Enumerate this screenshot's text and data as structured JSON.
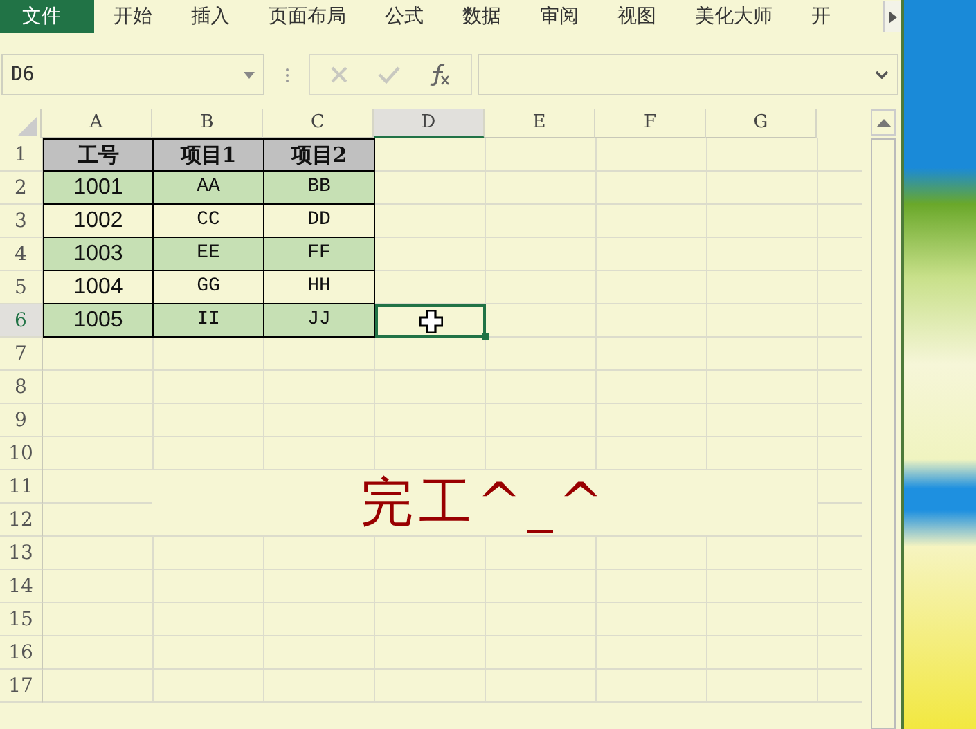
{
  "ribbon_tabs": [
    {
      "label": "文件",
      "selected": true
    },
    {
      "label": "开始",
      "selected": false
    },
    {
      "label": "插入",
      "selected": false
    },
    {
      "label": "页面布局",
      "selected": false
    },
    {
      "label": "公式",
      "selected": false
    },
    {
      "label": "数据",
      "selected": false
    },
    {
      "label": "审阅",
      "selected": false
    },
    {
      "label": "视图",
      "selected": false
    },
    {
      "label": "美化大师",
      "selected": false
    },
    {
      "label": "开",
      "selected": false
    }
  ],
  "name_box": {
    "value": "D6"
  },
  "sheet": {
    "columns": [
      {
        "label": "A",
        "selected": false
      },
      {
        "label": "B",
        "selected": false
      },
      {
        "label": "C",
        "selected": false
      },
      {
        "label": "D",
        "selected": true
      },
      {
        "label": "E",
        "selected": false
      },
      {
        "label": "F",
        "selected": false
      },
      {
        "label": "G",
        "selected": false
      }
    ],
    "rows": [
      {
        "number": "1",
        "selected": false,
        "kind": "header",
        "cells": [
          "工号",
          "项目1",
          "项目2"
        ]
      },
      {
        "number": "2",
        "selected": false,
        "kind": "shaded",
        "cells": [
          "1001",
          "AA",
          "BB"
        ]
      },
      {
        "number": "3",
        "selected": false,
        "kind": "plain",
        "cells": [
          "1002",
          "CC",
          "DD"
        ]
      },
      {
        "number": "4",
        "selected": false,
        "kind": "shaded",
        "cells": [
          "1003",
          "EE",
          "FF"
        ]
      },
      {
        "number": "5",
        "selected": false,
        "kind": "plain",
        "cells": [
          "1004",
          "GG",
          "HH"
        ]
      },
      {
        "number": "6",
        "selected": true,
        "kind": "shaded",
        "cells": [
          "1005",
          "II",
          "JJ"
        ]
      },
      {
        "number": "7",
        "selected": false
      },
      {
        "number": "8",
        "selected": false
      },
      {
        "number": "9",
        "selected": false
      },
      {
        "number": "10",
        "selected": false
      },
      {
        "number": "11",
        "selected": false
      },
      {
        "number": "12",
        "selected": false
      },
      {
        "number": "13",
        "selected": false
      },
      {
        "number": "14",
        "selected": false
      },
      {
        "number": "15",
        "selected": false
      },
      {
        "number": "16",
        "selected": false
      },
      {
        "number": "17",
        "selected": false
      }
    ]
  },
  "text_box": {
    "text": "完工^_^"
  }
}
